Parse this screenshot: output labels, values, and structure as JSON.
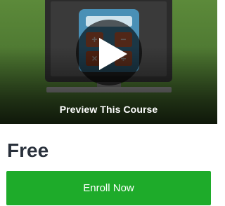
{
  "preview": {
    "label": "Preview This Course",
    "calculator_keys": [
      "+",
      "−",
      "×",
      "÷"
    ],
    "calculator_key_colors": [
      "#d4683f",
      "#d4683f",
      "#c9572f",
      "#d4683f"
    ]
  },
  "pricing": {
    "price": "Free",
    "enroll_label": "Enroll Now",
    "accent_color": "#1eab2a"
  }
}
